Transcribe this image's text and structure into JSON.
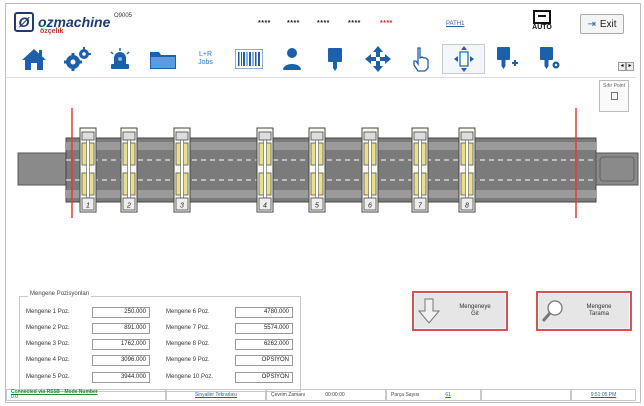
{
  "header": {
    "brand": "ozmachine",
    "brand_sub": "özçelik",
    "machine_code": "O9005",
    "password_groups": [
      "****",
      "****",
      "****",
      "****"
    ],
    "password_red": "****",
    "path_link": "PATH1",
    "auto_label": "AUTO",
    "exit_label": "Exit"
  },
  "toolbar": {
    "items": [
      {
        "icon": "home-icon"
      },
      {
        "icon": "gears-icon"
      },
      {
        "icon": "alarm-light-icon"
      },
      {
        "icon": "folder-icon"
      },
      {
        "icon": "jobs-icon",
        "label": "L+R\nJobs"
      },
      {
        "icon": "barcode-icon"
      },
      {
        "icon": "user-icon"
      },
      {
        "icon": "spindle-icon"
      },
      {
        "icon": "move-arrows-icon"
      },
      {
        "icon": "hand-pointer-icon"
      },
      {
        "icon": "clamp-center-icon"
      },
      {
        "icon": "spindle-add-icon"
      },
      {
        "icon": "spindle-settings-icon"
      }
    ]
  },
  "zero_point": {
    "label": "Sıfır Point"
  },
  "clamps": {
    "labels": [
      "1",
      "2",
      "3",
      "4",
      "5",
      "6",
      "7",
      "8"
    ]
  },
  "positions": {
    "title": "Mengene Pozisyonları",
    "left": [
      {
        "label": "Mengene 1 Poz.",
        "value": "250.000"
      },
      {
        "label": "Mengene 2 Poz.",
        "value": "891.000"
      },
      {
        "label": "Mengene 3 Poz.",
        "value": "1762.000"
      },
      {
        "label": "Mengene 4 Poz.",
        "value": "3096.000"
      },
      {
        "label": "Mengene 5 Poz.",
        "value": "3944.000"
      }
    ],
    "right": [
      {
        "label": "Mengene 6 Poz.",
        "value": "4780.000"
      },
      {
        "label": "Mengene 7 Poz.",
        "value": "5574.000"
      },
      {
        "label": "Mengene 8 Poz.",
        "value": "6262.000"
      },
      {
        "label": "Mengene 9 Poz.",
        "value": "OPSİYON"
      },
      {
        "label": "Mengene 10 Poz.",
        "value": "OPSİYON"
      }
    ]
  },
  "actions": {
    "go_clamps": "Mengeneye\nGit",
    "scan_clamps": "Mengene\nTarama"
  },
  "status": {
    "connection": "Connected via RS5B - Mode Number",
    "connection_sub": "0.0",
    "errors_link": "Sinyaller Tekrarlası",
    "cycle_label": "Çevrim Zamanı",
    "cycle_value": "00:00:00",
    "parts_label": "Parça Sayısı",
    "parts_value": "61",
    "time": "9:51:05 PM"
  },
  "colors": {
    "accent_blue": "#2a7ad0",
    "clamp_yellow": "#e8e08a",
    "limit_red": "#e23b3b",
    "button_border_red": "#d05555"
  }
}
